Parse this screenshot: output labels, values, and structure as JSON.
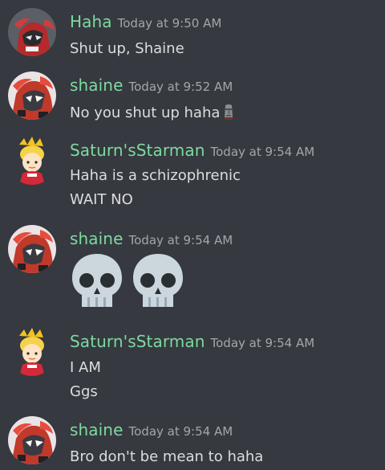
{
  "colors": {
    "background": "#36393f",
    "username": "#7ed9a0",
    "timestamp": "#a3a6aa",
    "message_text": "#dcddde"
  },
  "messages": [
    {
      "author": "Haha",
      "timestamp": "Today at 9:50 AM",
      "avatar": "haha-avatar-icon",
      "lines": [
        "Shut up, Shaine"
      ]
    },
    {
      "author": "shaine",
      "timestamp": "Today at 9:52 AM",
      "avatar": "shaine-avatar-icon",
      "lines": [
        "No you shut up haha"
      ],
      "trailing_emoji": "moai-emoji-icon"
    },
    {
      "author": "Saturn'sStarman",
      "timestamp": "Today at 9:54 AM",
      "avatar": "starman-avatar-icon",
      "lines": [
        "Haha is a schizophrenic",
        "WAIT NO"
      ]
    },
    {
      "author": "shaine",
      "timestamp": "Today at 9:54 AM",
      "avatar": "shaine-avatar-icon",
      "emojis": [
        "skull-emoji-icon",
        "skull-emoji-icon"
      ]
    },
    {
      "author": "Saturn'sStarman",
      "timestamp": "Today at 9:54 AM",
      "avatar": "starman-avatar-icon",
      "lines": [
        "I AM",
        "Ggs"
      ]
    },
    {
      "author": "shaine",
      "timestamp": "Today at 9:54 AM",
      "avatar": "shaine-avatar-icon",
      "lines": [
        "Bro don't be mean to haha"
      ]
    }
  ]
}
